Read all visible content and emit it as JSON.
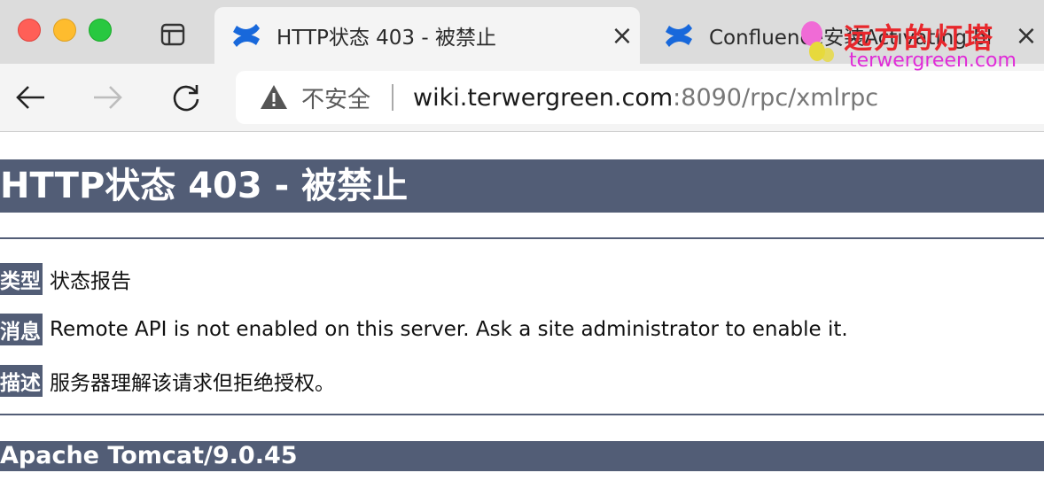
{
  "browser": {
    "tabs": [
      {
        "title": "HTTP状态 403 - 被禁止",
        "close": "×"
      },
      {
        "title": "Confluence安装Activating bl",
        "close": "×"
      }
    ],
    "address": {
      "security_label": "不安全",
      "host": "wiki.terwergreen.com",
      "rest": ":8090/rpc/xmlrpc"
    }
  },
  "watermark": {
    "text_cn": "远方的灯塔",
    "text_en": "terwergreen.com"
  },
  "page": {
    "heading": "HTTP状态 403 - 被禁止",
    "type_label": "类型",
    "type_value": "状态报告",
    "message_label": "消息",
    "message_value": "Remote API is not enabled on this server. Ask a site administrator to enable it.",
    "desc_label": "描述",
    "desc_value": "服务器理解该请求但拒绝授权。",
    "footer": "Apache Tomcat/9.0.45"
  },
  "colors": {
    "accent": "#525d76",
    "tab_active": "#f4f4f4",
    "tabbar": "#dcdcdc"
  }
}
